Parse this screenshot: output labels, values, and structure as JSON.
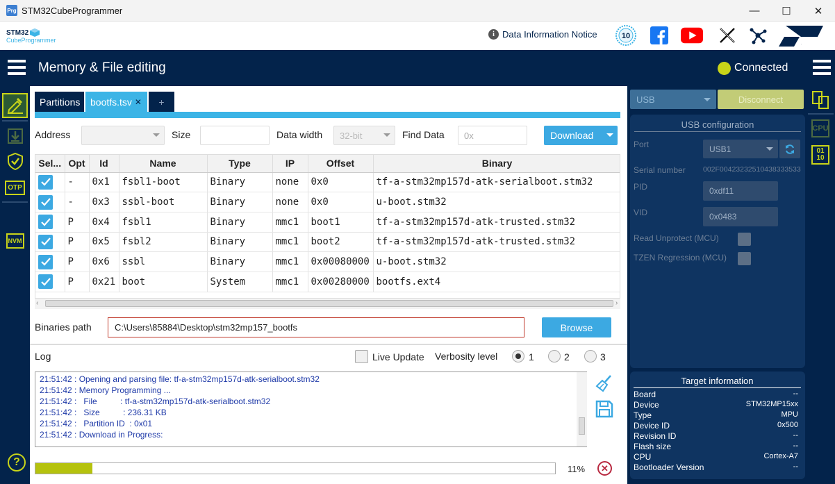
{
  "window": {
    "title": "STM32CubeProgrammer",
    "icon_text": "Prg",
    "minimize": "—",
    "maximize": "☐",
    "close": "✕"
  },
  "brand": {
    "logo_line1": "STM32",
    "logo_line2": "CubeProgrammer",
    "notice": "Data Information Notice",
    "anniversary": "10",
    "st_logo": "ST"
  },
  "header": {
    "title": "Memory & File editing",
    "status": "Connected",
    "status_color": "#c8d419"
  },
  "sidebar_left": {
    "help": "?",
    "otp": "OTP",
    "nvm": "NVM"
  },
  "tabs": [
    {
      "label": "Partitions"
    },
    {
      "label": "bootfs.tsv",
      "close": "✕"
    },
    {
      "label": "+"
    }
  ],
  "toolbar": {
    "address_label": "Address",
    "address_value": "",
    "size_label": "Size",
    "size_value": "",
    "data_width_label": "Data width",
    "data_width_value": "32-bit",
    "find_label": "Find Data",
    "find_placeholder": "0x",
    "download_label": "Download"
  },
  "table": {
    "columns": [
      "Sel...",
      "Opt",
      "Id",
      "Name",
      "Type",
      "IP",
      "Offset",
      "Binary"
    ],
    "rows": [
      {
        "selected": true,
        "opt": "-",
        "id": "0x1",
        "name": "fsbl1-boot",
        "type": "Binary",
        "ip": "none",
        "offset": "0x0",
        "binary": "tf-a-stm32mp157d-atk-serialboot.stm32"
      },
      {
        "selected": true,
        "opt": "-",
        "id": "0x3",
        "name": "ssbl-boot",
        "type": "Binary",
        "ip": "none",
        "offset": "0x0",
        "binary": "u-boot.stm32"
      },
      {
        "selected": true,
        "opt": "P",
        "id": "0x4",
        "name": "fsbl1",
        "type": "Binary",
        "ip": "mmc1",
        "offset": "boot1",
        "binary": "tf-a-stm32mp157d-atk-trusted.stm32"
      },
      {
        "selected": true,
        "opt": "P",
        "id": "0x5",
        "name": "fsbl2",
        "type": "Binary",
        "ip": "mmc1",
        "offset": "boot2",
        "binary": "tf-a-stm32mp157d-atk-trusted.stm32"
      },
      {
        "selected": true,
        "opt": "P",
        "id": "0x6",
        "name": "ssbl",
        "type": "Binary",
        "ip": "mmc1",
        "offset": "0x00080000",
        "binary": "u-boot.stm32"
      },
      {
        "selected": true,
        "opt": "P",
        "id": "0x21",
        "name": "boot",
        "type": "System",
        "ip": "mmc1",
        "offset": "0x00280000",
        "binary": "bootfs.ext4"
      }
    ]
  },
  "binaries": {
    "label": "Binaries path",
    "value": "C:\\Users\\85884\\Desktop\\stm32mp157_bootfs",
    "browse_label": "Browse"
  },
  "log": {
    "label": "Log",
    "live_update": "Live Update",
    "live_update_checked": false,
    "verbosity_label": "Verbosity level",
    "verbosity_options": [
      "1",
      "2",
      "3"
    ],
    "verbosity_selected": "1",
    "lines": [
      "21:51:42 : Opening and parsing file: tf-a-stm32mp157d-atk-serialboot.stm32",
      "21:51:42 : Memory Programming ...",
      "21:51:42 :   File          : tf-a-stm32mp157d-atk-serialboot.stm32",
      "21:51:42 :   Size          : 236.31 KB",
      "21:51:42 :   Partition ID  : 0x01",
      "21:51:42 : Download in Progress:"
    ]
  },
  "progress": {
    "value": 0.11,
    "label": "11%"
  },
  "connection": {
    "interface": "USB",
    "disconnect_label": "Disconnect",
    "config_title": "USB configuration",
    "port_label": "Port",
    "port_value": "USB1",
    "serial_label": "Serial number",
    "serial_value": "002F00423232510438333533",
    "pid_label": "PID",
    "pid_value": "0xdf11",
    "vid_label": "VID",
    "vid_value": "0x0483",
    "read_unprotect_label": "Read Unprotect (MCU)",
    "tzen_label": "TZEN Regression (MCU)"
  },
  "target": {
    "title": "Target information",
    "fields": [
      {
        "label": "Board",
        "value": "--"
      },
      {
        "label": "Device",
        "value": "STM32MP15xx"
      },
      {
        "label": "Type",
        "value": "MPU"
      },
      {
        "label": "Device ID",
        "value": "0x500"
      },
      {
        "label": "Revision ID",
        "value": "--"
      },
      {
        "label": "Flash size",
        "value": "--"
      },
      {
        "label": "CPU",
        "value": "Cortex-A7"
      },
      {
        "label": "Bootloader Version",
        "value": "--"
      }
    ]
  },
  "sidebar_right": {
    "cpu": "CPU",
    "bits_top": "01",
    "bits_bottom": "10"
  },
  "colors": {
    "navy": "#03234b",
    "accent": "#3ca9e2",
    "lime": "#c8d419",
    "progress": "#b5c20e"
  }
}
